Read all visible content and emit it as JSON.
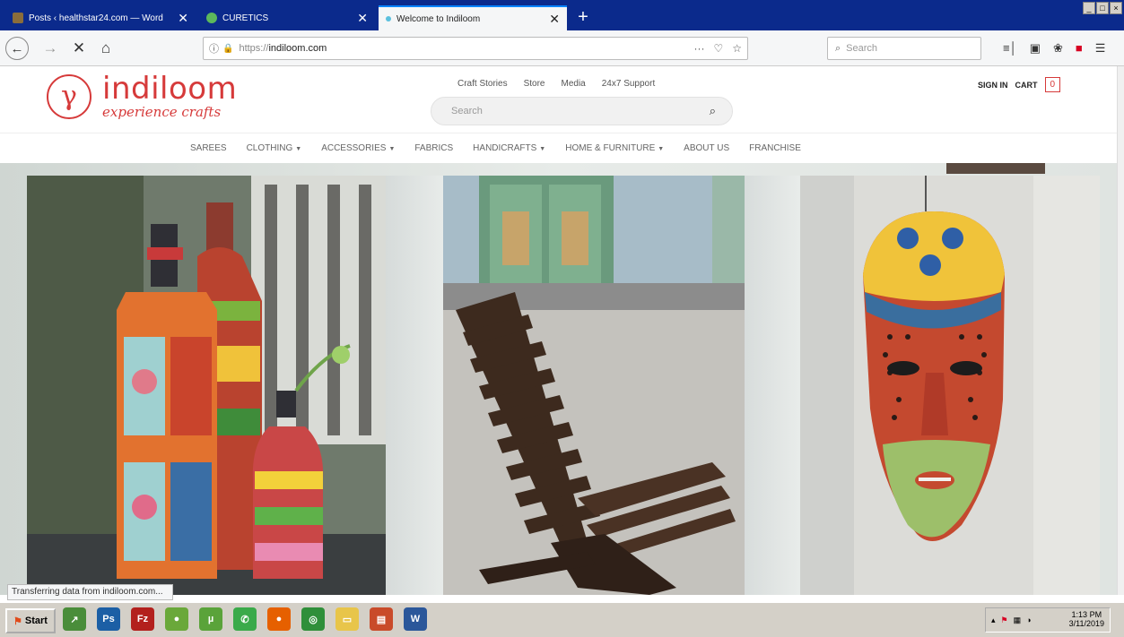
{
  "browser": {
    "tabs": [
      {
        "title": "Posts ‹ healthstar24.com — Word",
        "favicon_color": "#8a6d3b",
        "active": false
      },
      {
        "title": "CURETICS",
        "favicon_color": "#5cb85c",
        "active": false
      },
      {
        "title": "Welcome to Indiloom",
        "favicon_color": "#5bc0de",
        "active": true
      }
    ],
    "close_glyph": "✕",
    "new_tab_glyph": "+",
    "window_controls": [
      "_",
      "□",
      "×"
    ],
    "nav": {
      "back": "←",
      "forward": "→",
      "stop": "✕",
      "home": "⌂"
    },
    "url": {
      "info_icon": "ⓘ",
      "lock_icon": "▲",
      "protocol": "https://",
      "host": "indiloom.com",
      "menu": "···",
      "pocket": "♡",
      "star": "☆"
    },
    "search_placeholder": "Search",
    "search_icon": "⌕",
    "toolbar_icons": [
      "library-icon",
      "sidebar-icon",
      "extension-icon",
      "addon-icon",
      "menu-icon"
    ],
    "toolbar_glyphs": [
      "≡│",
      "▣",
      "❀",
      "■",
      "☰"
    ]
  },
  "site": {
    "logo": {
      "mark": "γ",
      "name": "indiloom",
      "tagline": "experience crafts"
    },
    "top_links": [
      "Craft Stories",
      "Store",
      "Media",
      "24x7 Support"
    ],
    "search_placeholder": "Search",
    "search_icon": "⌕",
    "sign_in": "SIGN IN",
    "cart_label": "CART",
    "cart_count": "0",
    "categories": [
      {
        "label": "SAREES",
        "dropdown": false
      },
      {
        "label": "CLOTHING",
        "dropdown": true
      },
      {
        "label": "ACCESSORIES",
        "dropdown": true
      },
      {
        "label": "FABRICS",
        "dropdown": false
      },
      {
        "label": "HANDICRAFTS",
        "dropdown": true
      },
      {
        "label": "HOME & FURNITURE",
        "dropdown": true
      },
      {
        "label": "ABOUT US",
        "dropdown": false
      },
      {
        "label": "FRANCHISE",
        "dropdown": false
      }
    ],
    "caret": "▼",
    "accent_color": "#d63a3a"
  },
  "status_text": "Transferring data from indiloom.com...",
  "taskbar": {
    "start_label": "Start",
    "start_flag": "⚑",
    "apps": [
      {
        "name": "chart-app-icon",
        "glyph": "↗",
        "color": "#4a8d3a"
      },
      {
        "name": "photoshop-icon",
        "glyph": "Ps",
        "color": "#1c5fa5"
      },
      {
        "name": "filezilla-icon",
        "glyph": "Fz",
        "color": "#b3201d"
      },
      {
        "name": "dreamweaver-icon",
        "glyph": "●",
        "color": "#6aa83a"
      },
      {
        "name": "utorrent-icon",
        "glyph": "µ",
        "color": "#5aa33a"
      },
      {
        "name": "whatsapp-icon",
        "glyph": "✆",
        "color": "#3aaa4a"
      },
      {
        "name": "firefox-icon",
        "glyph": "●",
        "color": "#e66000"
      },
      {
        "name": "chrome-icon",
        "glyph": "◎",
        "color": "#2f8f3a"
      },
      {
        "name": "folder-icon",
        "glyph": "▭",
        "color": "#e8c54a"
      },
      {
        "name": "powerpoint-icon",
        "glyph": "▤",
        "color": "#c94b2a"
      },
      {
        "name": "word-icon",
        "glyph": "W",
        "color": "#2b579a"
      }
    ],
    "tray_icons": [
      "▴",
      "⚑",
      "▦",
      "◑"
    ],
    "time": "1:13 PM",
    "date": "3/11/2019"
  }
}
